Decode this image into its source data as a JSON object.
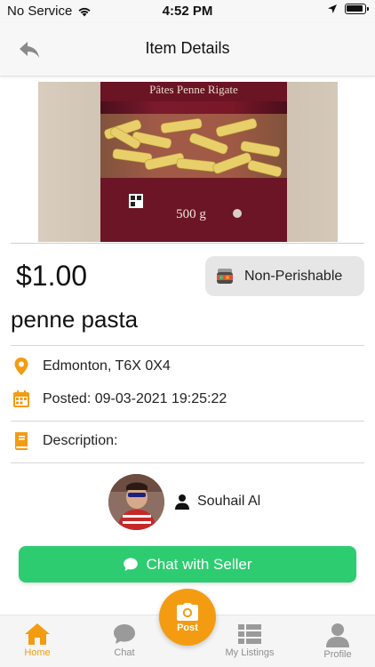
{
  "status_bar": {
    "carrier": "No Service",
    "time": "4:52 PM"
  },
  "header": {
    "title": "Item Details"
  },
  "product_image": {
    "package_text": "Pâtes Penne Rigate",
    "weight_text": "500 g"
  },
  "item": {
    "price": "$1.00",
    "category": "Non-Perishable",
    "title": "penne pasta",
    "location": "Edmonton, T6X 0X4",
    "posted": "Posted: 09-03-2021 19:25:22",
    "description_label": "Description:"
  },
  "seller": {
    "name": "Souhail Al"
  },
  "chat_button": {
    "label": "Chat with Seller"
  },
  "tabs": [
    {
      "label": "Home",
      "icon": "home-icon",
      "active": true
    },
    {
      "label": "Chat",
      "icon": "chat-bubble-icon",
      "active": false
    },
    {
      "label": "My Listings",
      "icon": "list-icon",
      "active": false
    },
    {
      "label": "Profile",
      "icon": "person-icon",
      "active": false
    }
  ],
  "post_button": {
    "label": "Post"
  },
  "colors": {
    "accent": "#f39c12",
    "chat_button": "#2ecc71"
  }
}
